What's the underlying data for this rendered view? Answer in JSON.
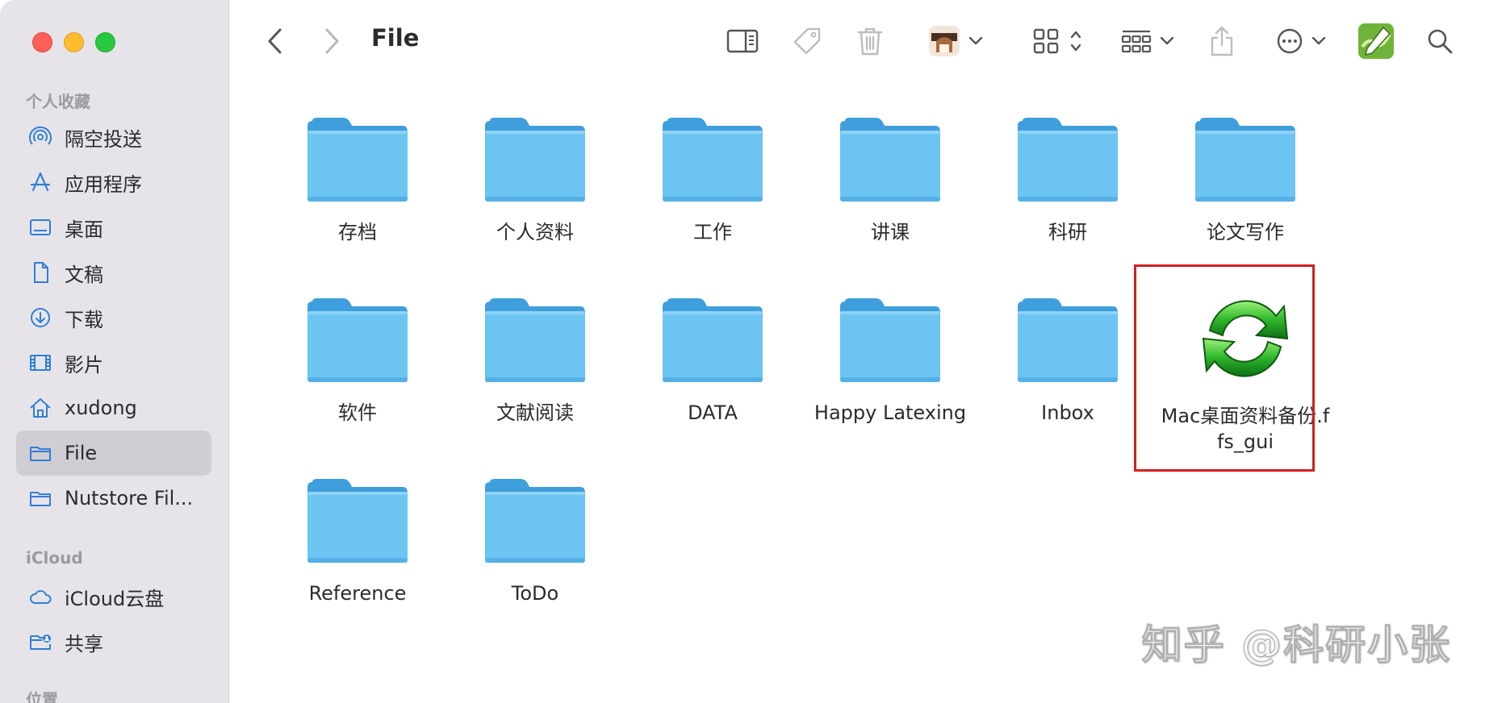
{
  "window": {
    "title": "File"
  },
  "sidebar": {
    "favorites_header": "个人收藏",
    "favorites": [
      {
        "label": "隔空投送",
        "icon": "airdrop-icon"
      },
      {
        "label": "应用程序",
        "icon": "applications-icon"
      },
      {
        "label": "桌面",
        "icon": "desktop-icon"
      },
      {
        "label": "文稿",
        "icon": "document-icon"
      },
      {
        "label": "下载",
        "icon": "download-icon"
      },
      {
        "label": "影片",
        "icon": "film-icon"
      },
      {
        "label": "xudong",
        "icon": "home-icon"
      },
      {
        "label": "File",
        "icon": "folder-icon",
        "selected": true
      },
      {
        "label": "Nutstore Fil...",
        "icon": "folder-icon"
      }
    ],
    "icloud_header": "iCloud",
    "icloud": [
      {
        "label": "iCloud云盘",
        "icon": "cloud-icon"
      },
      {
        "label": "共享",
        "icon": "shared-folder-icon"
      }
    ],
    "locations_header": "位置"
  },
  "items": [
    {
      "label": "存档",
      "type": "folder"
    },
    {
      "label": "个人资料",
      "type": "folder"
    },
    {
      "label": "工作",
      "type": "folder"
    },
    {
      "label": "讲课",
      "type": "folder"
    },
    {
      "label": "科研",
      "type": "folder"
    },
    {
      "label": "论文写作",
      "type": "folder"
    },
    {
      "label": "软件",
      "type": "folder"
    },
    {
      "label": "文献阅读",
      "type": "folder"
    },
    {
      "label": "DATA",
      "type": "folder"
    },
    {
      "label": "Happy Latexing",
      "type": "folder"
    },
    {
      "label": "Inbox",
      "type": "folder"
    },
    {
      "label": "Mac桌面资料备份.ffs_gui",
      "type": "ffs-file",
      "highlighted": true
    },
    {
      "label": "Reference",
      "type": "folder"
    },
    {
      "label": "ToDo",
      "type": "folder"
    }
  ],
  "watermark": "知乎 @科研小张",
  "colors": {
    "sidebar_bg": "#e7e4e9",
    "folder_body": "#6cc4f2",
    "folder_tab": "#3e9fdc",
    "accent_blue": "#2f7fd6",
    "highlight_border": "#d3201f"
  }
}
